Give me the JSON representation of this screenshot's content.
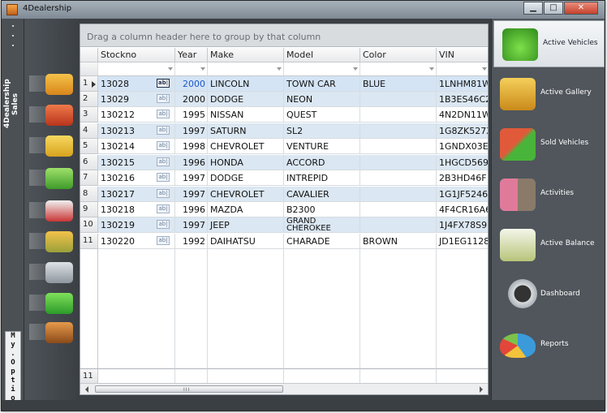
{
  "window": {
    "title": "4Dealership",
    "minimize_glyph": "▁",
    "maximize_glyph": "□",
    "close_glyph": "✕"
  },
  "left_strip": {
    "sales_label": "4Dealership Sales",
    "options_label": "M\ny\n.\nO\np\nt\ni\no\nn\ns"
  },
  "left_icons": [
    {
      "name": "car-icon",
      "color": "#e8a21b"
    },
    {
      "name": "cars-icon",
      "color": "#d24a2a"
    },
    {
      "name": "money-icon",
      "color": "#e8b830"
    },
    {
      "name": "calculator-icon",
      "color": "#6cbf3a"
    },
    {
      "name": "chart-pen-icon",
      "color": "#cc3b3b"
    },
    {
      "name": "growth-chart-icon",
      "color": "#e2a12a"
    },
    {
      "name": "tools-icon",
      "color": "#b0b7be"
    },
    {
      "name": "puzzle-icon",
      "color": "#3fae3a"
    },
    {
      "name": "exit-door-icon",
      "color": "#c8762a"
    }
  ],
  "grid": {
    "group_hint": "Drag a column header here to group by that column",
    "columns": [
      "Stockno",
      "Year",
      "Make",
      "Model",
      "Color",
      "VIN"
    ],
    "ab_glyph": "ab|",
    "rows": [
      {
        "n": "1",
        "stockno": "13028",
        "year": "2000",
        "make": "LINCOLN",
        "model": "TOWN CAR",
        "color": "BLUE",
        "vin": "1LNHM81W"
      },
      {
        "n": "2",
        "stockno": "13029",
        "year": "2000",
        "make": "DODGE",
        "model": "NEON",
        "color": "",
        "vin": "1B3ES46C2"
      },
      {
        "n": "3",
        "stockno": "130212",
        "year": "1995",
        "make": "NISSAN",
        "model": "QUEST",
        "color": "",
        "vin": "4N2DN11W"
      },
      {
        "n": "4",
        "stockno": "130213",
        "year": "1997",
        "make": "SATURN",
        "model": "SL2",
        "color": "",
        "vin": "1G8ZK527X"
      },
      {
        "n": "5",
        "stockno": "130214",
        "year": "1998",
        "make": "CHEVROLET",
        "model": "VENTURE",
        "color": "",
        "vin": "1GNDX03E"
      },
      {
        "n": "6",
        "stockno": "130215",
        "year": "1996",
        "make": "HONDA",
        "model": "ACCORD",
        "color": "",
        "vin": "1HGCD569"
      },
      {
        "n": "7",
        "stockno": "130216",
        "year": "1997",
        "make": "DODGE",
        "model": "INTREPID",
        "color": "",
        "vin": "2B3HD46F"
      },
      {
        "n": "8",
        "stockno": "130217",
        "year": "1997",
        "make": "CHEVROLET",
        "model": "CAVALIER",
        "color": "",
        "vin": "1G1JF5246"
      },
      {
        "n": "9",
        "stockno": "130218",
        "year": "1996",
        "make": "MAZDA",
        "model": "B2300",
        "color": "",
        "vin": "4F4CR16A6"
      },
      {
        "n": "10",
        "stockno": "130219",
        "year": "1997",
        "make": "JEEP",
        "model": "GRAND CHEROKEE",
        "color": "",
        "vin": "1J4FX78S9"
      },
      {
        "n": "11",
        "stockno": "130220",
        "year": "1992",
        "make": "DAIHATSU",
        "model": "CHARADE",
        "color": "BROWN",
        "vin": "JD1EG1128"
      }
    ],
    "footer_count": "11",
    "scroll_grip": "III"
  },
  "right_nav": [
    {
      "label": "Active Vehicles",
      "icon": "green-car-icon",
      "color": "#4caf2a",
      "active": true
    },
    {
      "label": "Active Gallery",
      "icon": "gallery-camera-icon",
      "color": "#e3a72a",
      "active": false
    },
    {
      "label": "Sold Vehicles",
      "icon": "sold-car-dollar-icon",
      "color": "#3aa33a",
      "active": false
    },
    {
      "label": "Activities",
      "icon": "people-icon",
      "color": "#d46a8a",
      "active": false
    },
    {
      "label": "Active Balance",
      "icon": "balance-sheet-icon",
      "color": "#c9d0a0",
      "active": false
    },
    {
      "label": "Dashboard",
      "icon": "speedometer-icon",
      "color": "#e4e7ea",
      "active": false
    },
    {
      "label": "Reports",
      "icon": "pie-chart-icon",
      "color": "#3b9ad9",
      "active": false
    }
  ]
}
